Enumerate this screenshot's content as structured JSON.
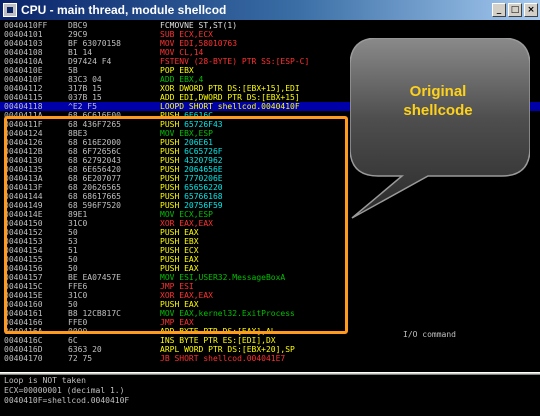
{
  "window": {
    "title": "CPU - main thread, module shellcod",
    "minimize_glyph": "_",
    "maximize_glyph": "□",
    "close_glyph": "×"
  },
  "colors": {
    "highlight_border": "#ff9a1f",
    "callout_text": "#ffd21a",
    "selected_row": "#0000a8"
  },
  "code_rows": [
    {
      "addr": "0040410FF",
      "hex": "DBC9",
      "dis": [
        {
          "t": "FCMOVNE ST,ST(1)",
          "c": "wht"
        }
      ]
    },
    {
      "addr": "00404101",
      "hex": "29C9",
      "dis": [
        {
          "t": "SUB ECX,ECX",
          "c": "red"
        }
      ]
    },
    {
      "addr": "00404103",
      "hex": "BF 63070158",
      "dis": [
        {
          "t": "MOV EDI,58010763",
          "c": "red"
        }
      ]
    },
    {
      "addr": "00404108",
      "hex": "B1 14",
      "dis": [
        {
          "t": "MOV CL,14",
          "c": "red"
        }
      ]
    },
    {
      "addr": "0040410A",
      "hex": "D97424 F4",
      "dis": [
        {
          "t": "FSTENV (28-BYTE) PTR SS:[ESP-C]",
          "c": "red"
        }
      ]
    },
    {
      "addr": "0040410E",
      "hex": "5B",
      "dis": [
        {
          "t": "POP EBX",
          "c": "yel"
        }
      ]
    },
    {
      "addr": "0040410F",
      "hex": "83C3 04",
      "dis": [
        {
          "t": "ADD EBX,4",
          "c": "grn"
        }
      ]
    },
    {
      "addr": "00404112",
      "hex": "317B 15",
      "dis": [
        {
          "t": "XOR DWORD PTR DS:[EBX+15],EDI",
          "c": "yel"
        }
      ]
    },
    {
      "addr": "00404115",
      "hex": "037B 15",
      "dis": [
        {
          "t": "ADD EDI,DWORD PTR DS:[EBX+15]",
          "c": "yel"
        }
      ]
    },
    {
      "addr": "00404118",
      "hex": "^E2 F5",
      "dis": [
        {
          "t": "LOOPD SHORT shellcod.0040410F",
          "c": "yel"
        }
      ],
      "selected": true
    },
    {
      "addr": "0040411A",
      "hex": "68 6C616E00",
      "dis": [
        {
          "t": "PUSH ",
          "c": "yel"
        },
        {
          "t": "6E616C",
          "c": "cyn"
        }
      ]
    },
    {
      "addr": "0040411F",
      "hex": "68 436F7265",
      "dis": [
        {
          "t": "PUSH ",
          "c": "yel"
        },
        {
          "t": "65726F43",
          "c": "cyn"
        }
      ]
    },
    {
      "addr": "00404124",
      "hex": "8BE3",
      "dis": [
        {
          "t": "MOV EBX,ESP",
          "c": "grn"
        }
      ]
    },
    {
      "addr": "00404126",
      "hex": "68 616E2000",
      "dis": [
        {
          "t": "PUSH ",
          "c": "yel"
        },
        {
          "t": "206E61",
          "c": "cyn"
        }
      ]
    },
    {
      "addr": "0040412B",
      "hex": "68 6F72656C",
      "dis": [
        {
          "t": "PUSH ",
          "c": "yel"
        },
        {
          "t": "6C65726F",
          "c": "cyn"
        }
      ]
    },
    {
      "addr": "00404130",
      "hex": "68 62792043",
      "dis": [
        {
          "t": "PUSH ",
          "c": "yel"
        },
        {
          "t": "43207962",
          "c": "cyn"
        }
      ]
    },
    {
      "addr": "00404135",
      "hex": "68 6E656420",
      "dis": [
        {
          "t": "PUSH ",
          "c": "yel"
        },
        {
          "t": "2064656E",
          "c": "cyn"
        }
      ]
    },
    {
      "addr": "0040413A",
      "hex": "68 6E207077",
      "dis": [
        {
          "t": "PUSH ",
          "c": "yel"
        },
        {
          "t": "7770206E",
          "c": "cyn"
        }
      ]
    },
    {
      "addr": "0040413F",
      "hex": "68 20626565",
      "dis": [
        {
          "t": "PUSH ",
          "c": "yel"
        },
        {
          "t": "65656220",
          "c": "cyn"
        }
      ]
    },
    {
      "addr": "00404144",
      "hex": "68 68617665",
      "dis": [
        {
          "t": "PUSH ",
          "c": "yel"
        },
        {
          "t": "65766168",
          "c": "cyn"
        }
      ]
    },
    {
      "addr": "00404149",
      "hex": "68 596F7520",
      "dis": [
        {
          "t": "PUSH ",
          "c": "yel"
        },
        {
          "t": "20756F59",
          "c": "cyn"
        }
      ]
    },
    {
      "addr": "0040414E",
      "hex": "89E1",
      "dis": [
        {
          "t": "MOV ECX,ESP",
          "c": "grn"
        }
      ]
    },
    {
      "addr": "00404150",
      "hex": "31C0",
      "dis": [
        {
          "t": "XOR EAX,EAX",
          "c": "red"
        }
      ]
    },
    {
      "addr": "00404152",
      "hex": "50",
      "dis": [
        {
          "t": "PUSH EAX",
          "c": "yel"
        }
      ]
    },
    {
      "addr": "00404153",
      "hex": "53",
      "dis": [
        {
          "t": "PUSH EBX",
          "c": "yel"
        }
      ]
    },
    {
      "addr": "00404154",
      "hex": "51",
      "dis": [
        {
          "t": "PUSH ECX",
          "c": "yel"
        }
      ]
    },
    {
      "addr": "00404155",
      "hex": "50",
      "dis": [
        {
          "t": "PUSH EAX",
          "c": "yel"
        }
      ]
    },
    {
      "addr": "00404156",
      "hex": "50",
      "dis": [
        {
          "t": "PUSH EAX",
          "c": "yel"
        }
      ]
    },
    {
      "addr": "00404157",
      "hex": "BE EA07457E",
      "dis": [
        {
          "t": "MOV ESI,",
          "c": "grn"
        },
        {
          "t": "USER32.MessageBoxA",
          "c": "grn"
        }
      ]
    },
    {
      "addr": "0040415C",
      "hex": "FFE6",
      "dis": [
        {
          "t": "JMP ESI",
          "c": "red"
        }
      ]
    },
    {
      "addr": "0040415E",
      "hex": "31C0",
      "dis": [
        {
          "t": "XOR EAX,EAX",
          "c": "red"
        }
      ]
    },
    {
      "addr": "00404160",
      "hex": "50",
      "dis": [
        {
          "t": "PUSH EAX",
          "c": "yel"
        }
      ]
    },
    {
      "addr": "00404161",
      "hex": "B8 12CB817C",
      "dis": [
        {
          "t": "MOV EAX,",
          "c": "grn"
        },
        {
          "t": "kernel32.ExitProcess",
          "c": "grn"
        }
      ]
    },
    {
      "addr": "00404166",
      "hex": "FFE0",
      "dis": [
        {
          "t": "JMP EAX",
          "c": "red"
        }
      ]
    },
    {
      "addr": "0040416A",
      "hex": "0000",
      "dis": [
        {
          "t": "ADD BYTE PTR DS:[EAX],AL",
          "c": "yel"
        }
      ]
    },
    {
      "addr": "0040416C",
      "hex": "6C",
      "dis": [
        {
          "t": "INS BYTE PTR ES:[EDI],DX",
          "c": "yel"
        }
      ]
    },
    {
      "addr": "0040416D",
      "hex": "6363 20",
      "dis": [
        {
          "t": "ARPL WORD PTR DS:[EBX+20],SP",
          "c": "yel"
        }
      ]
    },
    {
      "addr": "00404170",
      "hex": "72 75",
      "dis": [
        {
          "t": "JB SHORT shellcod.004041E7",
          "c": "red"
        }
      ]
    }
  ],
  "io_comment": "I/O command",
  "callout": {
    "line1": "Original",
    "line2": "shellcode"
  },
  "info_pane": [
    "Loop is NOT taken",
    "ECX=00000001 (decimal 1.)",
    "0040410F=shellcod.0040410F"
  ]
}
